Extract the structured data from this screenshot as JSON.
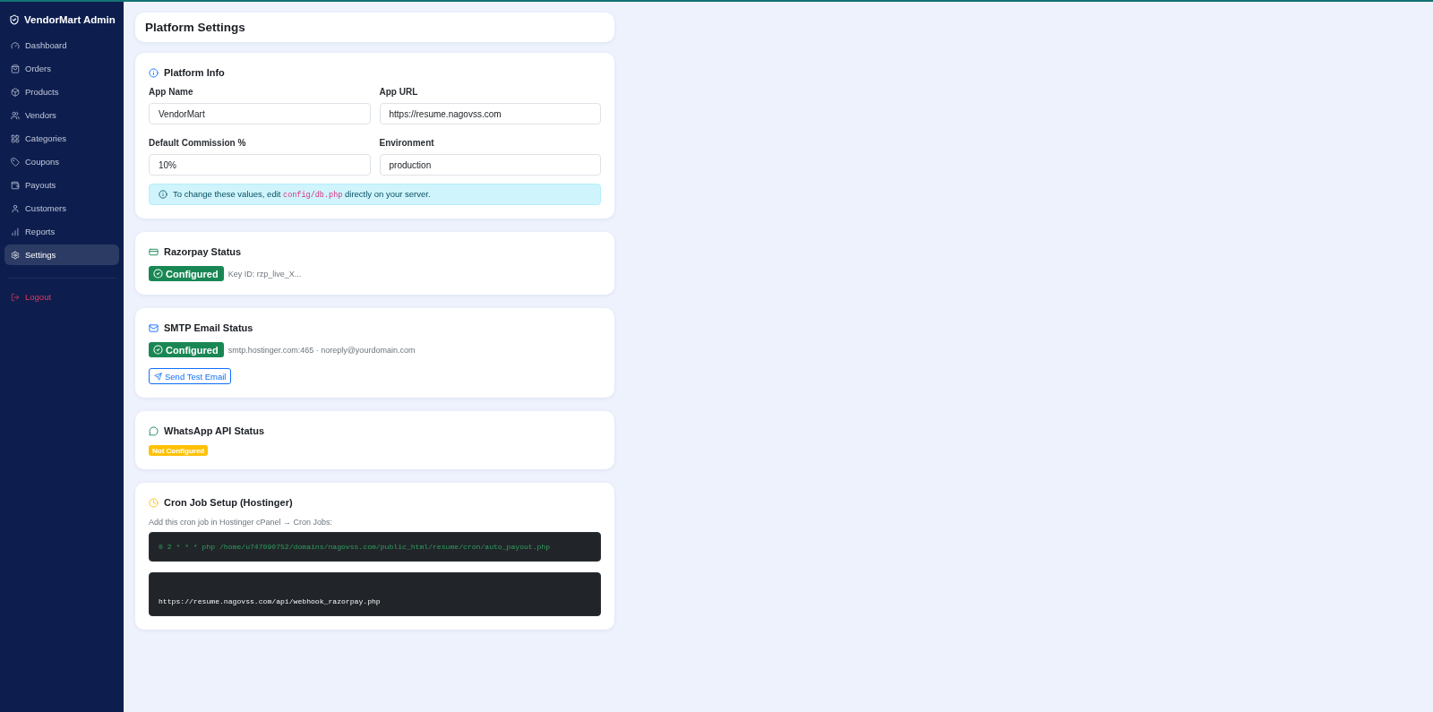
{
  "sidebar": {
    "brand": "VendorMart Admin",
    "items": [
      {
        "label": "Dashboard",
        "selected": false
      },
      {
        "label": "Orders",
        "selected": false
      },
      {
        "label": "Products",
        "selected": false
      },
      {
        "label": "Vendors",
        "selected": false
      },
      {
        "label": "Categories",
        "selected": false
      },
      {
        "label": "Coupons",
        "selected": false
      },
      {
        "label": "Payouts",
        "selected": false
      },
      {
        "label": "Customers",
        "selected": false
      },
      {
        "label": "Reports",
        "selected": false
      },
      {
        "label": "Settings",
        "selected": true
      }
    ],
    "logout": "Logout"
  },
  "header": {
    "title": "Platform Settings"
  },
  "platform_info": {
    "title": "Platform Info",
    "fields": [
      {
        "label": "App Name",
        "value": "VendorMart"
      },
      {
        "label": "App URL",
        "value": "https://resume.nagovss.com"
      },
      {
        "label": "Default Commission %",
        "value": "10%"
      },
      {
        "label": "Environment",
        "value": "production"
      }
    ],
    "note": {
      "text_before": "To change these values, edit",
      "code": "config/db.php",
      "text_after": "directly on your server."
    }
  },
  "razorpay_status": {
    "title": "Razorpay Status",
    "badge": {
      "kind": "configured",
      "label": "Configured"
    },
    "detail": "Key ID: rzp_live_X..."
  },
  "smtp_status": {
    "title": "SMTP Email Status",
    "badge": {
      "kind": "configured",
      "label": "Configured"
    },
    "detail": "smtp.hostinger.com:465 · noreply@yourdomain.com",
    "button": "Send Test Email"
  },
  "whatsapp_status": {
    "title": "WhatsApp API Status",
    "badge": {
      "kind": "not_configured",
      "label": "Not Configured"
    }
  },
  "cron_setup": {
    "title": "Cron Job Setup (Hostinger)",
    "hint": "Add this cron job in Hostinger cPanel → Cron Jobs:",
    "code_blocks": [
      {
        "kind": "command",
        "text": "0 2 * * * php /home/u747090752/domains/nagovss.com/public_html/resume/cron/auto_payout.php"
      },
      {
        "kind": "url",
        "text": "https://resume.nagovss.com/api/webhook_razorpay.php"
      }
    ]
  }
}
